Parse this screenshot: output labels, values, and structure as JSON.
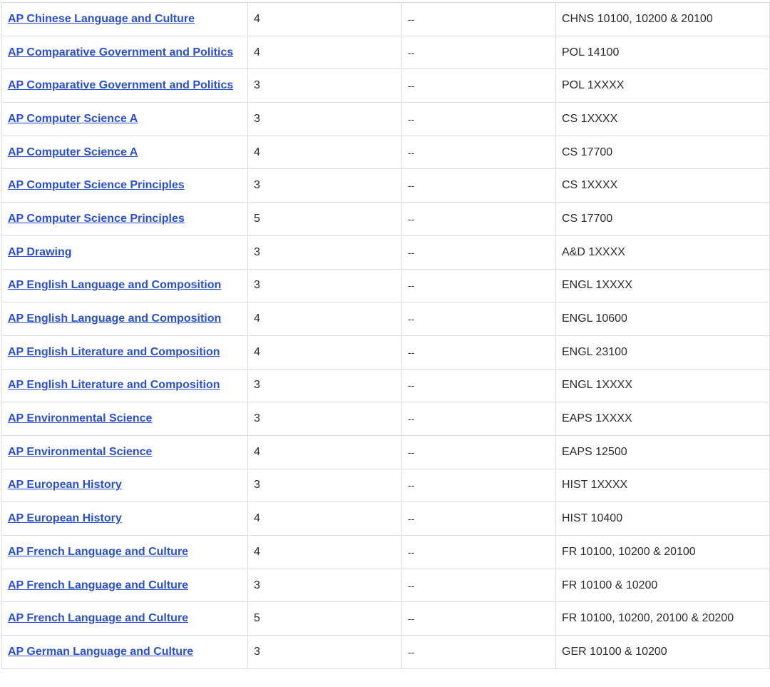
{
  "rows": [
    {
      "course": "AP Chinese Language and Culture",
      "score": "4",
      "other": "--",
      "equivalent": "CHNS 10100, 10200 & 20100"
    },
    {
      "course": "AP Comparative Government and Politics",
      "score": "4",
      "other": "--",
      "equivalent": "POL 14100"
    },
    {
      "course": "AP Comparative Government and Politics",
      "score": "3",
      "other": "--",
      "equivalent": "POL 1XXXX"
    },
    {
      "course": "AP Computer Science A",
      "score": "3",
      "other": "--",
      "equivalent": "CS 1XXXX"
    },
    {
      "course": "AP Computer Science A",
      "score": "4",
      "other": "--",
      "equivalent": "CS 17700"
    },
    {
      "course": "AP Computer Science Principles",
      "score": "3",
      "other": "--",
      "equivalent": "CS 1XXXX"
    },
    {
      "course": "AP Computer Science Principles",
      "score": "5",
      "other": "--",
      "equivalent": "CS 17700"
    },
    {
      "course": "AP Drawing",
      "score": "3",
      "other": "--",
      "equivalent": "A&D 1XXXX"
    },
    {
      "course": "AP English Language and Composition",
      "score": "3",
      "other": "--",
      "equivalent": "ENGL 1XXXX"
    },
    {
      "course": "AP English Language and Composition",
      "score": "4",
      "other": "--",
      "equivalent": "ENGL 10600"
    },
    {
      "course": "AP English Literature and Composition",
      "score": "4",
      "other": "--",
      "equivalent": "ENGL 23100"
    },
    {
      "course": "AP English Literature and Composition",
      "score": "3",
      "other": "--",
      "equivalent": "ENGL 1XXXX"
    },
    {
      "course": "AP Environmental Science",
      "score": "3",
      "other": "--",
      "equivalent": "EAPS 1XXXX"
    },
    {
      "course": "AP Environmental Science",
      "score": "4",
      "other": "--",
      "equivalent": "EAPS 12500"
    },
    {
      "course": "AP European History",
      "score": "3",
      "other": "--",
      "equivalent": "HIST 1XXXX"
    },
    {
      "course": "AP European History",
      "score": "4",
      "other": "--",
      "equivalent": "HIST 10400"
    },
    {
      "course": "AP French Language and Culture",
      "score": "4",
      "other": "--",
      "equivalent": "FR 10100, 10200 & 20100"
    },
    {
      "course": "AP French Language and Culture",
      "score": "3",
      "other": "--",
      "equivalent": "FR 10100 & 10200"
    },
    {
      "course": "AP French Language and Culture",
      "score": "5",
      "other": "--",
      "equivalent": "FR 10100, 10200, 20100 & 20200"
    },
    {
      "course": "AP German Language and Culture",
      "score": "3",
      "other": "--",
      "equivalent": "GER 10100 & 10200"
    }
  ]
}
